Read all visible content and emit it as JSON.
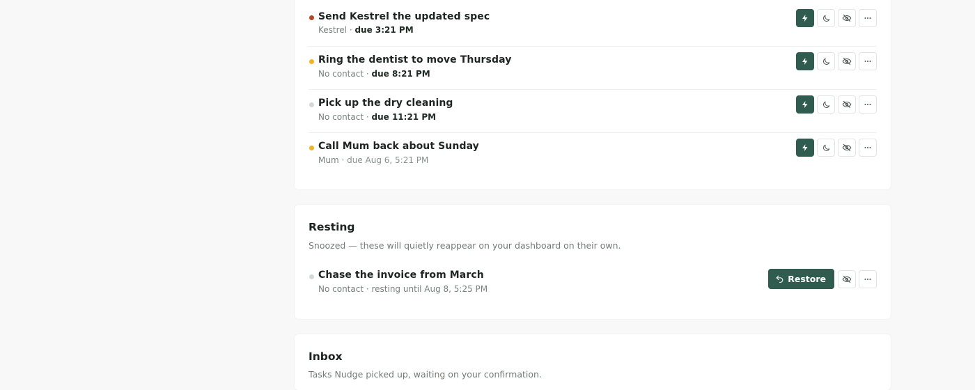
{
  "tasks": [
    {
      "title": "Send Kestrel the updated spec",
      "contact": "Kestrel",
      "separator": " · ",
      "due": "due 3:21 PM",
      "due_emphasis": true,
      "dot_color": "#b4482a"
    },
    {
      "title": "Ring the dentist to move Thursday",
      "contact": "No contact",
      "separator": " · ",
      "due": "due 8:21 PM",
      "due_emphasis": true,
      "dot_color": "#f0b323"
    },
    {
      "title": "Pick up the dry cleaning",
      "contact": "No contact",
      "separator": " · ",
      "due": "due 11:21 PM",
      "due_emphasis": true,
      "dot_color": "#d4d8d6"
    },
    {
      "title": "Call Mum back about Sunday",
      "contact": "Mum",
      "separator": " · ",
      "due": "due Aug 6, 5:21 PM",
      "due_emphasis": false,
      "dot_color": "#f0b323"
    }
  ],
  "resting": {
    "heading": "Resting",
    "description": "Snoozed — these will quietly reappear on your dashboard on their own.",
    "items": [
      {
        "title": "Chase the invoice from March",
        "subtitle": "No contact · resting until Aug 8, 5:25 PM",
        "dot_color": "#d4d8d6",
        "restore_label": "Restore"
      }
    ]
  },
  "inbox": {
    "heading": "Inbox",
    "description": "Tasks Nudge picked up, waiting on your confirmation."
  },
  "icons": {
    "focus": "lightning-icon",
    "snooze": "moon-icon",
    "hide": "eye-off-icon",
    "more": "more-horizontal-icon",
    "restore": "undo-arrow-icon"
  },
  "colors": {
    "accent": "#2f5c4f",
    "background": "#f7f8f7",
    "card": "#ffffff"
  }
}
